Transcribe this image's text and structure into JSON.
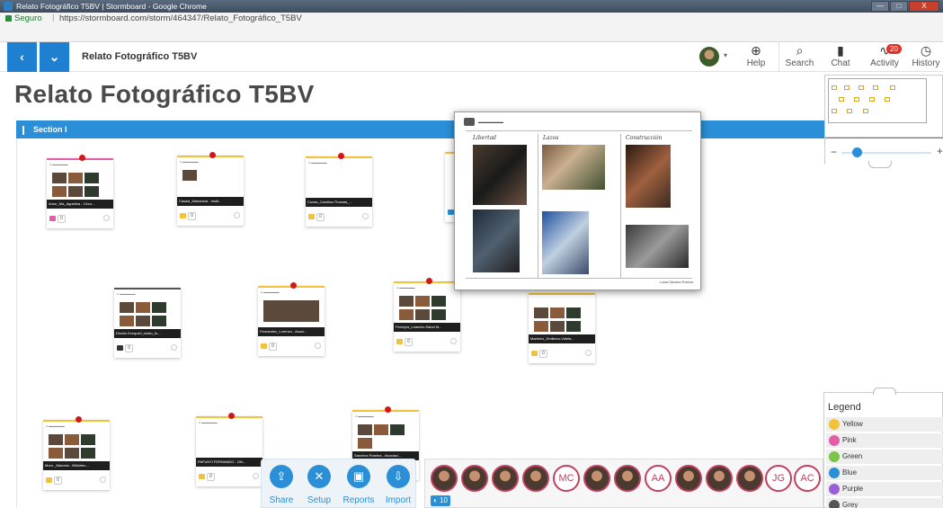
{
  "window": {
    "title": "Relato Fotográfico T5BV | Stormboard - Google Chrome",
    "buttons": [
      "—",
      "□",
      "X"
    ]
  },
  "address": {
    "secure_label": "Seguro",
    "url": "https://stormboard.com/storm/464347/Relato_Fotográfico_T5BV"
  },
  "appbar": {
    "board_name": "Relato Fotográfico T5BV",
    "tools": {
      "help": "Help",
      "search": "Search",
      "chat": "Chat",
      "activity": "Activity",
      "activity_badge": "20",
      "history": "History"
    }
  },
  "board": {
    "title": "Relato Fotográfico T5BV",
    "section": "Section I"
  },
  "cards": [
    {
      "label": "Amor_Ma_Agustina - Circu...",
      "count": "0",
      "color": "pink"
    },
    {
      "label": "Casasl_Marianela - Instit...",
      "count": "0",
      "color": "yellow"
    },
    {
      "label": "Cuvas_Carolina-Thomas_...",
      "count": "0",
      "color": "yellow"
    },
    {
      "label": "Dicelio Ezequiel_relato_fo...",
      "count": "0",
      "color": "grey"
    },
    {
      "label": "Fernandez_Lorenzo - Asoci...",
      "count": "0",
      "color": "yellow"
    },
    {
      "label": "Ferreyra_Leandro-Sabal M...",
      "count": "0",
      "color": "yellow"
    },
    {
      "label": "Martinez_Emiliano-Videla...",
      "count": "0",
      "color": "yellow"
    },
    {
      "label": "Moro _Marcela - Bibliotec...",
      "count": "0",
      "color": "yellow"
    },
    {
      "label": "PAFUNTI FERNANDO - ON...",
      "count": "0",
      "color": "yellow"
    },
    {
      "label": "Sanchez Romina - Asociaci...",
      "count": "0",
      "color": "yellow"
    },
    {
      "label": "",
      "count": "0",
      "color": "blue"
    }
  ],
  "preview": {
    "header": "▬▬▬▬▬▬▬",
    "columns": [
      "Libertad",
      "Lazos",
      "Construcción"
    ],
    "footer": "Lucas Sánchez Romina"
  },
  "legend": {
    "title": "Legend",
    "items": [
      {
        "label": "Yellow",
        "color": "#f2c23a"
      },
      {
        "label": "Pink",
        "color": "#e25fa8"
      },
      {
        "label": "Green",
        "color": "#7cc34a"
      },
      {
        "label": "Blue",
        "color": "#2a8fd6"
      },
      {
        "label": "Purple",
        "color": "#9a5fd6"
      },
      {
        "label": "Grey",
        "color": "#555555"
      }
    ]
  },
  "bottom_tools": {
    "share": "Share",
    "setup": "Setup",
    "reports": "Reports",
    "import": "Import"
  },
  "collaborators": {
    "initials": [
      "MC",
      "AA",
      "JG",
      "AC"
    ],
    "count": "10"
  },
  "colors": {
    "accent": "#2a8fd6",
    "nav": "#1f7fd0",
    "pin": "#d01818"
  }
}
